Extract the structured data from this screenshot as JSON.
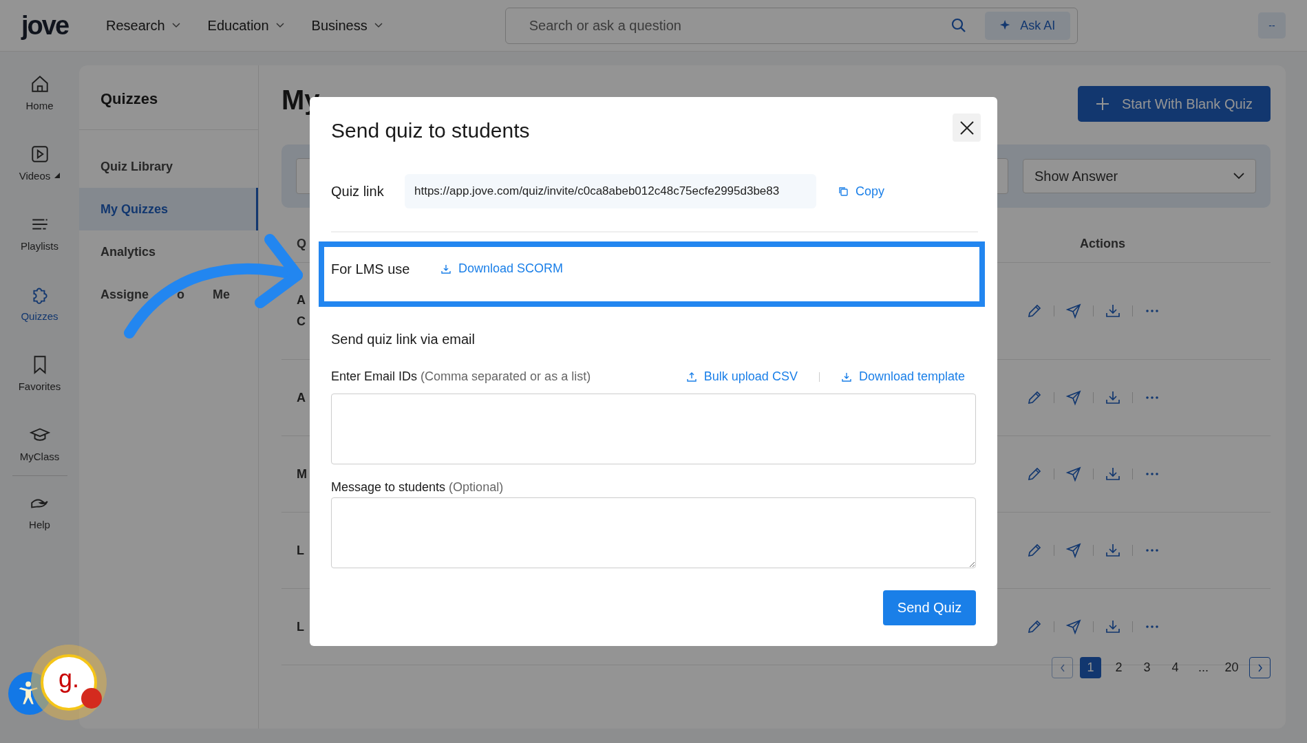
{
  "header": {
    "logo": "jove",
    "nav": [
      "Research",
      "Education",
      "Business"
    ],
    "search": {
      "placeholder": "Search or ask a question"
    },
    "ask_ai": "Ask AI",
    "avatar": "--"
  },
  "rail": [
    {
      "label": "Home",
      "selected": false,
      "expandable": false
    },
    {
      "label": "Videos",
      "selected": false,
      "expandable": true
    },
    {
      "label": "Playlists",
      "selected": false,
      "expandable": false
    },
    {
      "label": "Quizzes",
      "selected": true,
      "expandable": false
    },
    {
      "label": "Favorites",
      "selected": false,
      "expandable": false
    },
    {
      "label": "MyClass",
      "selected": false,
      "expandable": false
    },
    {
      "label": "Help",
      "selected": false,
      "expandable": false
    }
  ],
  "sidebar": {
    "title": "Quizzes",
    "items": [
      {
        "label": "Quiz Library",
        "selected": false
      },
      {
        "label": "My Quizzes",
        "selected": true
      },
      {
        "label": "Analytics",
        "selected": false
      },
      {
        "label": "Assigne o Me",
        "selected": false
      }
    ]
  },
  "main": {
    "title": "My",
    "create_button": "Start With Blank Quiz",
    "filter_dropdown": "Show Answer",
    "table": {
      "column_1": "Q",
      "actions_heading": "Actions",
      "rows": [
        {
          "lines": [
            "A",
            "C"
          ]
        },
        {
          "lines": [
            "A"
          ]
        },
        {
          "lines": [
            "M"
          ]
        },
        {
          "lines": [
            "L"
          ]
        },
        {
          "lines": [
            "L"
          ]
        }
      ]
    },
    "pagination": {
      "pages": [
        {
          "label": "1",
          "selected": true
        },
        {
          "label": "2",
          "selected": false
        },
        {
          "label": "3",
          "selected": false
        },
        {
          "label": "4",
          "selected": false
        },
        {
          "label": "...",
          "selected": false
        },
        {
          "label": "20",
          "selected": false
        }
      ]
    }
  },
  "modal": {
    "title": "Send quiz to students",
    "quiz_link_label": "Quiz link",
    "quiz_link": "https://app.jove.com/quiz/invite/c0ca8abeb012c48c75ecfe2995d3be83",
    "copy": "Copy",
    "lms_label": "For LMS use",
    "download_scorm": "Download SCORM",
    "email_heading": "Send quiz link via email",
    "email_label": "Enter Email IDs **(Comma separated or as a list)**",
    "bulk_upload": "Bulk upload CSV",
    "download_template": "Download template",
    "message_label": "Message to students **(Optional)**",
    "send_button": "Send Quiz"
  },
  "widget": {
    "badge": "g."
  }
}
